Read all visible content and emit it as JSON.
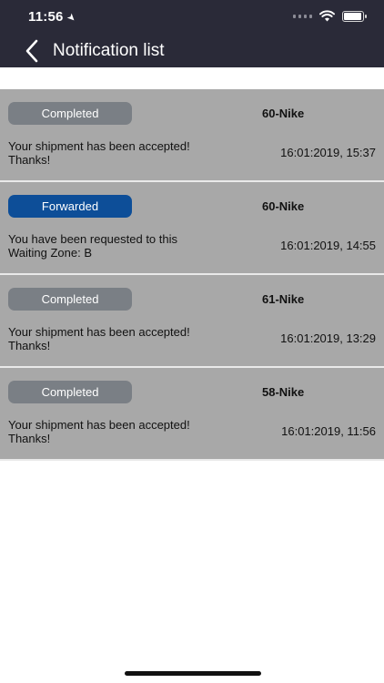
{
  "status_bar": {
    "time": "11:56",
    "location_icon": "location-arrow-icon",
    "icons": [
      "cellular-signal-icon",
      "wifi-icon",
      "battery-icon"
    ]
  },
  "header": {
    "title": "Notification list",
    "back_icon": "chevron-left-icon",
    "background_color": "#2a2a38"
  },
  "colors": {
    "card_background": "#a8a8a8",
    "completed_badge": "#7a7f85",
    "forwarded_badge": "#0d4e98"
  },
  "notifications": [
    {
      "status": "Completed",
      "ref": "60-Nike",
      "message": "Your shipment has been accepted! Thanks!",
      "datetime": "16:01:2019, 15:37"
    },
    {
      "status": "Forwarded",
      "ref": "60-Nike",
      "message": "You have been requested to this Waiting Zone: B",
      "datetime": "16:01:2019, 14:55"
    },
    {
      "status": "Completed",
      "ref": "61-Nike",
      "message": "Your shipment has been accepted! Thanks!",
      "datetime": "16:01:2019, 13:29"
    },
    {
      "status": "Completed",
      "ref": "58-Nike",
      "message": "Your shipment has been accepted! Thanks!",
      "datetime": "16:01:2019, 11:56"
    }
  ]
}
